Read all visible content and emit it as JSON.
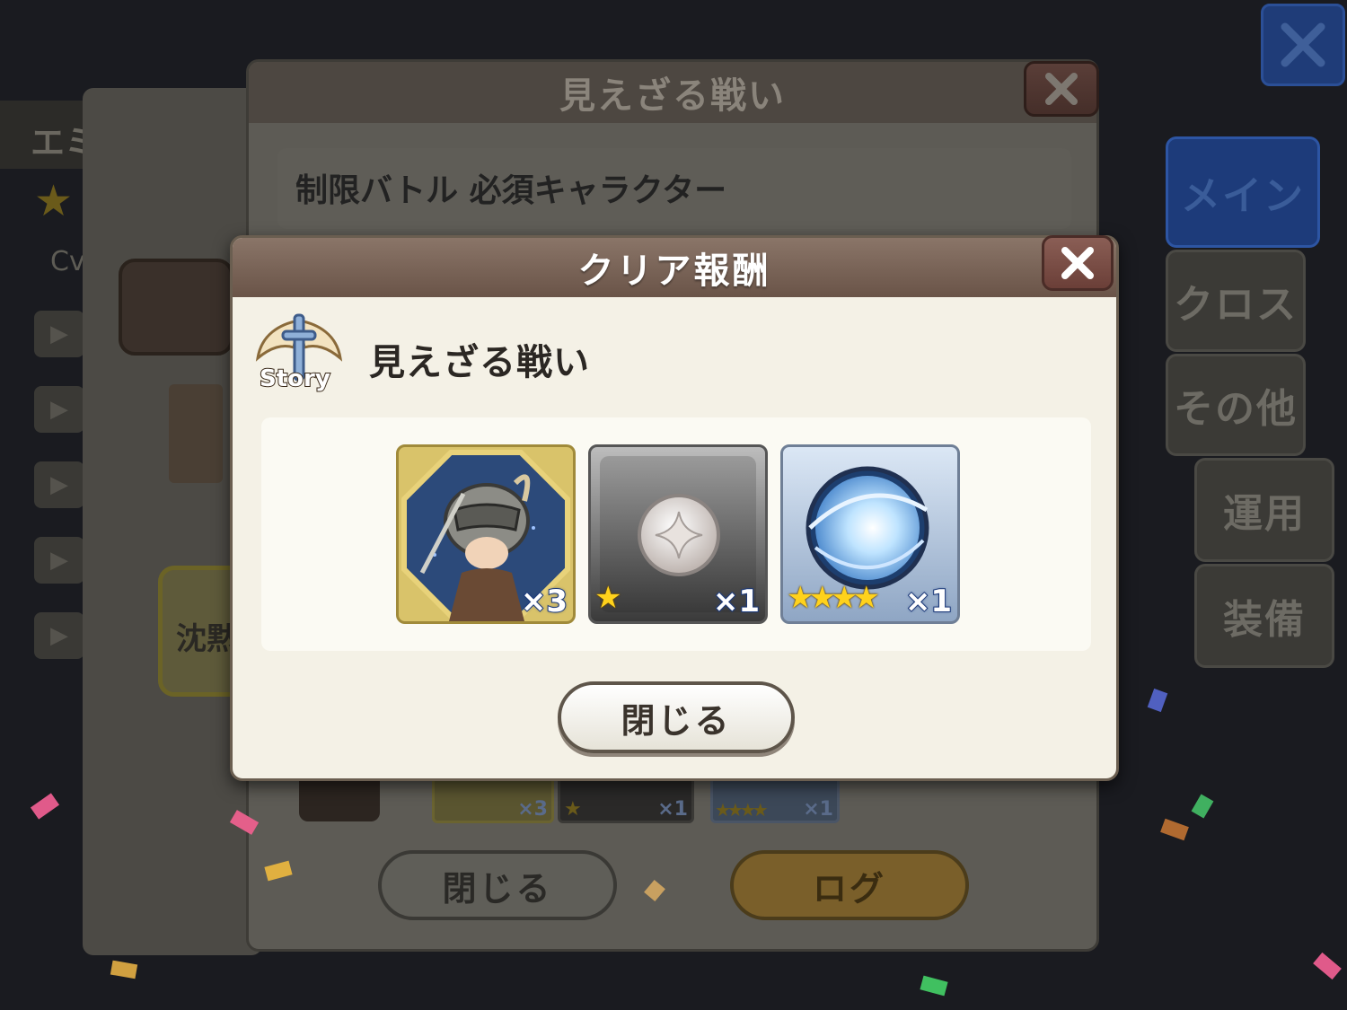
{
  "background": {
    "left_label": "エミ",
    "left_sub": "Cv",
    "left_button": "沈黙",
    "side_tabs": [
      "メイン",
      "クロス",
      "その他",
      "運用",
      "装備"
    ],
    "back_dialog": {
      "title": "見えざる戦い",
      "subtitle": "制限バトル 必須キャラクター",
      "close_label": "閉じる",
      "log_label": "ログ",
      "mini_rewards": [
        {
          "qty": "×3",
          "stars": ""
        },
        {
          "qty": "×1",
          "stars": "★"
        },
        {
          "qty": "×1",
          "stars": "★★★★"
        }
      ]
    }
  },
  "dialog": {
    "title": "クリア報酬",
    "stage_badge": "Story",
    "stage_name": "見えざる戦い",
    "rewards": [
      {
        "name": "character-unit-icon",
        "qty": "×3",
        "stars": ""
      },
      {
        "name": "silver-coin-icon",
        "qty": "×1",
        "stars": "★"
      },
      {
        "name": "water-orb-icon",
        "qty": "×1",
        "stars": "★★★★"
      }
    ],
    "close_label": "閉じる"
  },
  "colors": {
    "dialog_header": "#7a6458",
    "dialog_body": "#f4f1e6",
    "active_tab": "#1d3b7a",
    "qty_outline": "#1d3a7a",
    "star": "#ffd21c"
  }
}
